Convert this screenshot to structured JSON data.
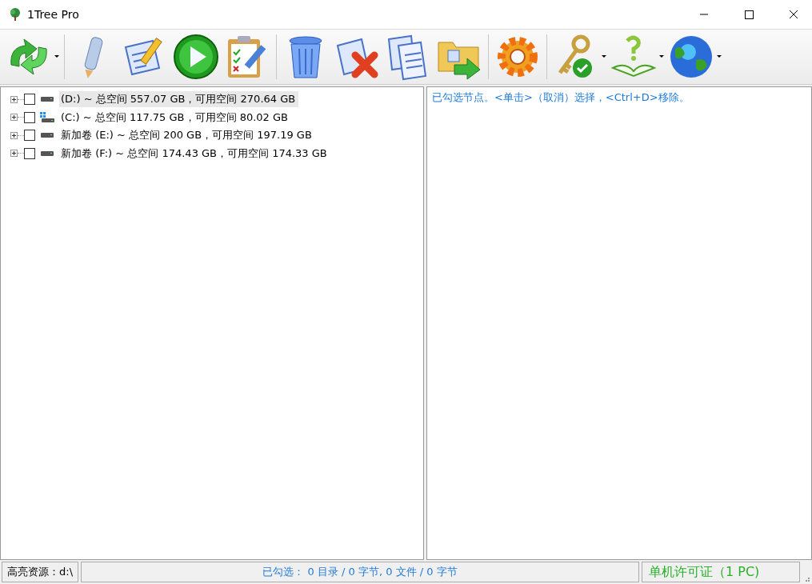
{
  "window": {
    "title": "1Tree Pro"
  },
  "toolbar": [
    [
      {
        "kind": "refresh",
        "dropdown": true
      }
    ],
    [
      {
        "kind": "pencil",
        "dropdown": false
      },
      {
        "kind": "edit-document",
        "dropdown": false
      },
      {
        "kind": "play",
        "dropdown": false
      },
      {
        "kind": "checklist",
        "dropdown": false
      }
    ],
    [
      {
        "kind": "trash",
        "dropdown": false
      },
      {
        "kind": "delete-document",
        "dropdown": false
      },
      {
        "kind": "copy",
        "dropdown": false
      },
      {
        "kind": "folder-move",
        "dropdown": false
      }
    ],
    [
      {
        "kind": "gear",
        "dropdown": false
      }
    ],
    [
      {
        "kind": "key",
        "dropdown": true
      },
      {
        "kind": "help",
        "dropdown": true
      },
      {
        "kind": "globe",
        "dropdown": true
      }
    ]
  ],
  "tree": [
    {
      "label": "(D:) ~ 总空间 557.07 GB，可用空间 270.64 GB",
      "kind": "disk",
      "checked": false,
      "expanded": false,
      "selected": true
    },
    {
      "label": "(C:) ~ 总空间 117.75 GB，可用空间 80.02 GB",
      "kind": "system",
      "checked": false,
      "expanded": false,
      "selected": false
    },
    {
      "label": "新加卷 (E:) ~ 总空间 200 GB，可用空间 197.19 GB",
      "kind": "disk",
      "checked": false,
      "expanded": false,
      "selected": false
    },
    {
      "label": "新加卷 (F:) ~ 总空间 174.43 GB，可用空间 174.33 GB",
      "kind": "disk",
      "checked": false,
      "expanded": false,
      "selected": false
    }
  ],
  "right_pane": {
    "hint": "已勾选节点。<单击>（取消）选择，<Ctrl+D>移除。"
  },
  "status_bar": {
    "highlight": "高亮资源：d:\\",
    "selection": "已勾选： 0 目录 / 0  字节, 0 文件 / 0  字节",
    "license": "单机许可证（1 PC)"
  }
}
